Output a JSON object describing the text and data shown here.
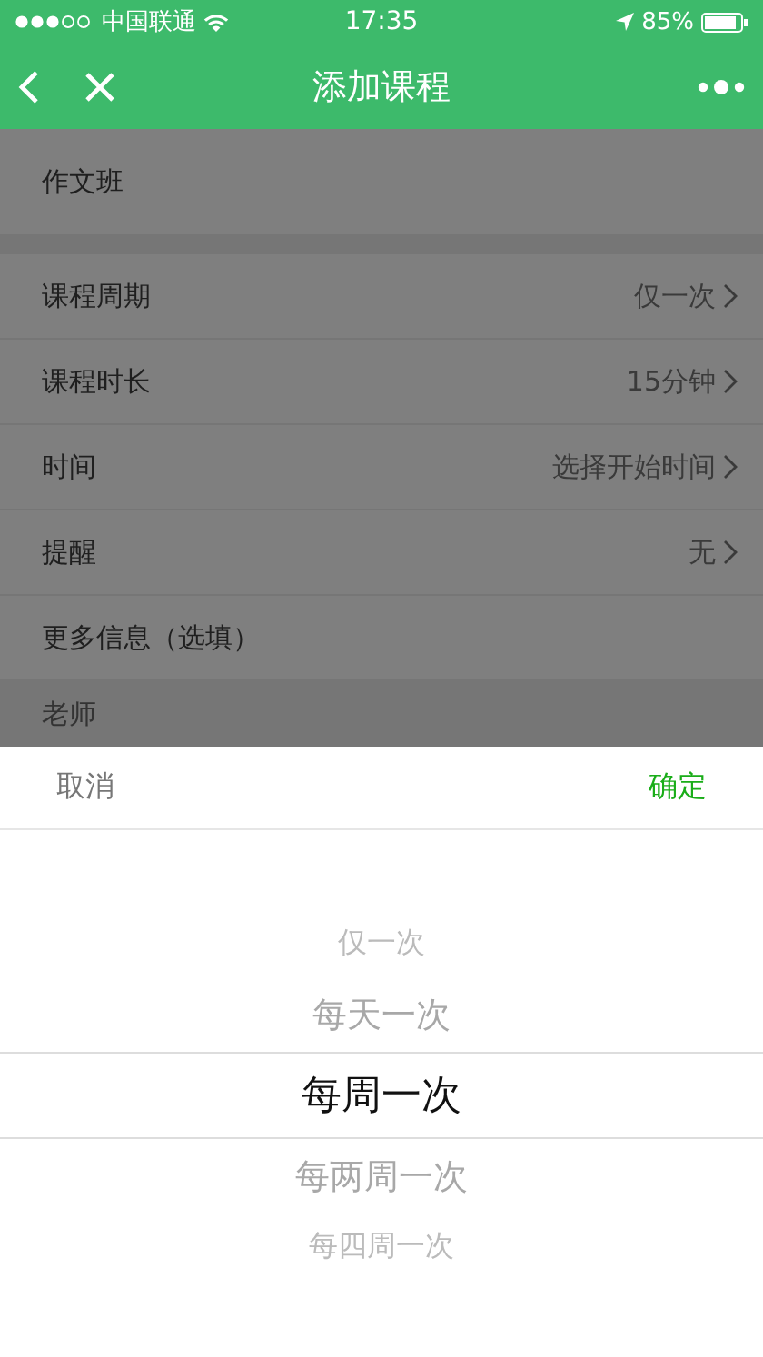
{
  "status_bar": {
    "carrier": "中国联通",
    "time": "17:35",
    "battery": "85%"
  },
  "nav": {
    "title": "添加课程"
  },
  "form": {
    "name_row": {
      "label": "作文班"
    },
    "rows": [
      {
        "label": "课程周期",
        "value": "仅一次"
      },
      {
        "label": "课程时长",
        "value": "15分钟"
      },
      {
        "label": "时间",
        "value": "选择开始时间"
      },
      {
        "label": "提醒",
        "value": "无"
      },
      {
        "label": "更多信息（选填）"
      }
    ],
    "section_label": "老师"
  },
  "picker": {
    "cancel": "取消",
    "confirm": "确定",
    "options": [
      {
        "label": "仅一次",
        "selected": false
      },
      {
        "label": "每天一次",
        "selected": false
      },
      {
        "label": "每周一次",
        "selected": true
      },
      {
        "label": "每两周一次",
        "selected": false
      },
      {
        "label": "每四周一次",
        "selected": false
      }
    ]
  }
}
